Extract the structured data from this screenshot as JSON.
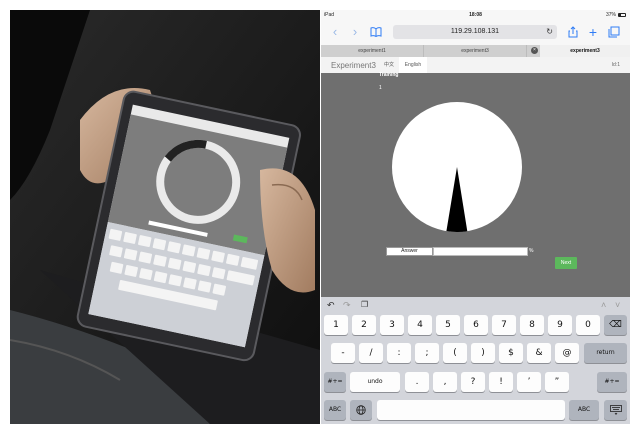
{
  "status_bar": {
    "device": "iPad",
    "time": "18:08",
    "battery": "37%"
  },
  "browser": {
    "url": "119.29.108.131",
    "tabs": [
      "experiment1",
      "experiment3",
      "experiment3"
    ],
    "active_tab_index": 2
  },
  "app": {
    "title": "Experiment3",
    "lang_chinese": "中文",
    "lang_english": "English",
    "user_id": "Id:1",
    "section_label": "Training",
    "trial_count": "1",
    "answer_button": "Answer",
    "answer_value": "",
    "percent_sign": "%",
    "next_button": "Next"
  },
  "keyboard": {
    "rows": [
      [
        "1",
        "2",
        "3",
        "4",
        "5",
        "6",
        "7",
        "8",
        "9",
        "0"
      ],
      [
        "-",
        "/",
        ":",
        ";",
        "(",
        ")",
        "$",
        "&",
        "@",
        "return"
      ],
      [
        "#+=",
        "undo",
        ".",
        ",",
        "?",
        "!",
        "’",
        "”",
        "#+="
      ],
      [
        "ABC",
        "",
        "ABC"
      ]
    ]
  },
  "colors": {
    "accent": "#2f7cf6",
    "next_green": "#5cb85c",
    "panel_gray": "#6f6f6f"
  }
}
